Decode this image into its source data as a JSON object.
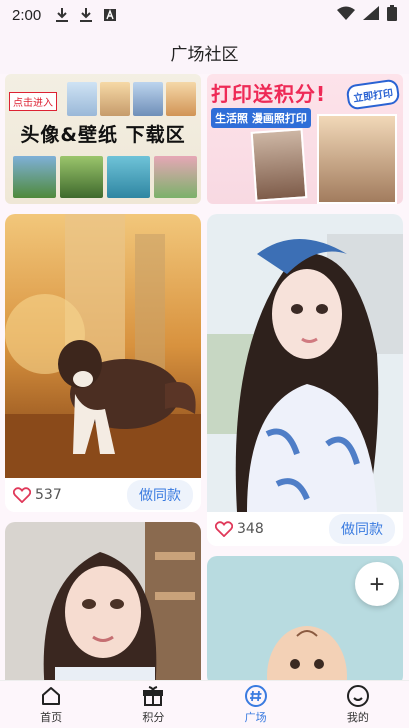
{
  "status_bar": {
    "time": "2:00",
    "icons": [
      "download-icon",
      "download-icon",
      "a-icon",
      "wifi-icon",
      "signal-icon",
      "battery-icon"
    ]
  },
  "header": {
    "title": "广场社区"
  },
  "banners": {
    "left": {
      "tag": "点击进入",
      "title": "头像&壁纸 下载区"
    },
    "right": {
      "title": "打印送积分!",
      "button": "立即打印",
      "subtitle": "生活照 漫画照打印"
    }
  },
  "feed": {
    "left_column": [
      {
        "type": "image",
        "subject": "dog",
        "likes": "537",
        "button": "做同款"
      },
      {
        "type": "image",
        "subject": "girl-portrait"
      }
    ],
    "right_column": [
      {
        "type": "image",
        "subject": "girl-blue-dress",
        "likes": "348",
        "button": "做同款"
      },
      {
        "type": "image",
        "subject": "baby"
      }
    ]
  },
  "fab": {
    "icon": "plus-icon",
    "label": "+"
  },
  "tabbar": {
    "items": [
      {
        "label": "首页",
        "icon": "home-icon",
        "active": false
      },
      {
        "label": "积分",
        "icon": "gift-icon",
        "active": false
      },
      {
        "label": "广场",
        "icon": "hash-icon",
        "active": true
      },
      {
        "label": "我的",
        "icon": "smile-icon",
        "active": false
      }
    ]
  },
  "colors": {
    "accent": "#3a7be0",
    "background": "#fdf6fb",
    "banner_red": "#ee2a56"
  }
}
